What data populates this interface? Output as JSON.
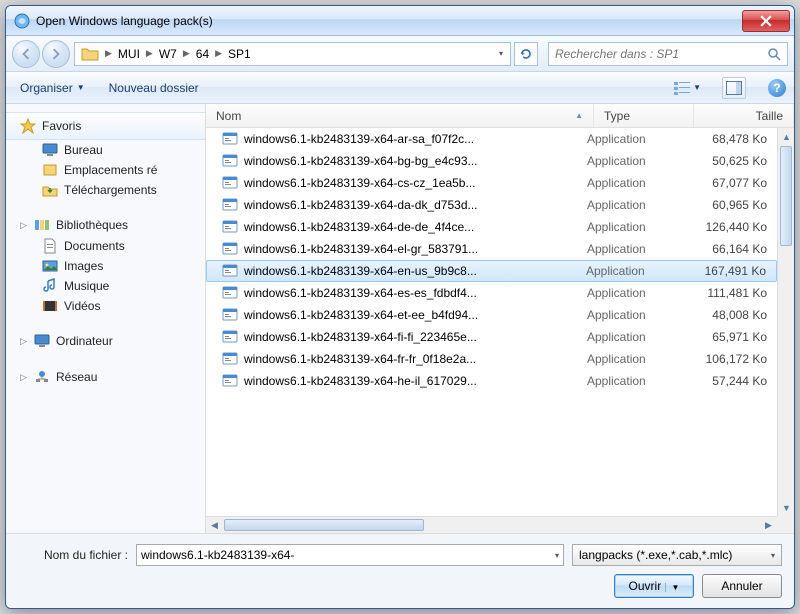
{
  "window": {
    "title": "Open Windows language pack(s)"
  },
  "breadcrumb": [
    "MUI",
    "W7",
    "64",
    "SP1"
  ],
  "search": {
    "placeholder": "Rechercher dans : SP1"
  },
  "toolbar": {
    "organize": "Organiser",
    "new_folder": "Nouveau dossier"
  },
  "sidebar": {
    "favorites": {
      "label": "Favoris",
      "items": [
        "Bureau",
        "Emplacements ré",
        "Téléchargements"
      ]
    },
    "libraries": {
      "label": "Bibliothèques",
      "items": [
        "Documents",
        "Images",
        "Musique",
        "Vidéos"
      ]
    },
    "computer": {
      "label": "Ordinateur"
    },
    "network": {
      "label": "Réseau"
    }
  },
  "columns": {
    "name": "Nom",
    "type": "Type",
    "size": "Taille"
  },
  "files": [
    {
      "name": "windows6.1-kb2483139-x64-ar-sa_f07f2c...",
      "type": "Application",
      "size": "68,478 Ko",
      "selected": false
    },
    {
      "name": "windows6.1-kb2483139-x64-bg-bg_e4c93...",
      "type": "Application",
      "size": "50,625 Ko",
      "selected": false
    },
    {
      "name": "windows6.1-kb2483139-x64-cs-cz_1ea5b...",
      "type": "Application",
      "size": "67,077 Ko",
      "selected": false
    },
    {
      "name": "windows6.1-kb2483139-x64-da-dk_d753d...",
      "type": "Application",
      "size": "60,965 Ko",
      "selected": false
    },
    {
      "name": "windows6.1-kb2483139-x64-de-de_4f4ce...",
      "type": "Application",
      "size": "126,440 Ko",
      "selected": false
    },
    {
      "name": "windows6.1-kb2483139-x64-el-gr_583791...",
      "type": "Application",
      "size": "66,164 Ko",
      "selected": false
    },
    {
      "name": "windows6.1-kb2483139-x64-en-us_9b9c8...",
      "type": "Application",
      "size": "167,491 Ko",
      "selected": true
    },
    {
      "name": "windows6.1-kb2483139-x64-es-es_fdbdf4...",
      "type": "Application",
      "size": "111,481 Ko",
      "selected": false
    },
    {
      "name": "windows6.1-kb2483139-x64-et-ee_b4fd94...",
      "type": "Application",
      "size": "48,008 Ko",
      "selected": false
    },
    {
      "name": "windows6.1-kb2483139-x64-fi-fi_223465e...",
      "type": "Application",
      "size": "65,971 Ko",
      "selected": false
    },
    {
      "name": "windows6.1-kb2483139-x64-fr-fr_0f18e2a...",
      "type": "Application",
      "size": "106,172 Ko",
      "selected": false
    },
    {
      "name": "windows6.1-kb2483139-x64-he-il_617029...",
      "type": "Application",
      "size": "57,244 Ko",
      "selected": false
    }
  ],
  "footer": {
    "filename_label": "Nom du fichier :",
    "filename_value": "windows6.1-kb2483139-x64-",
    "filter_label": "langpacks (*.exe,*.cab,*.mlc)",
    "open": "Ouvrir",
    "cancel": "Annuler"
  }
}
